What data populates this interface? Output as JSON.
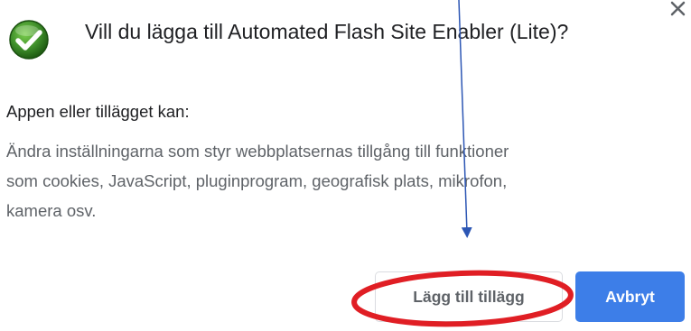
{
  "dialog": {
    "icon": "green-checkmark-icon",
    "title": "Vill du lägga till Automated Flash Site Enabler (Lite)?",
    "close_icon": "close-icon",
    "subheading": "Appen eller tillägget kan:",
    "description_lines": [
      "Ändra inställningarna som styr webbplatsernas tillgång till funktioner",
      "som cookies, JavaScript, pluginprogram, geografisk plats, mikrofon,",
      "kamera osv."
    ],
    "buttons": {
      "add_label": "Lägg till tillägg",
      "cancel_label": "Avbryt"
    }
  },
  "colors": {
    "primary_button": "#3d7ee8",
    "checkmark": "#3e8e2a",
    "annotation_circle": "#e01e24",
    "annotation_arrow": "#2c56b4"
  }
}
